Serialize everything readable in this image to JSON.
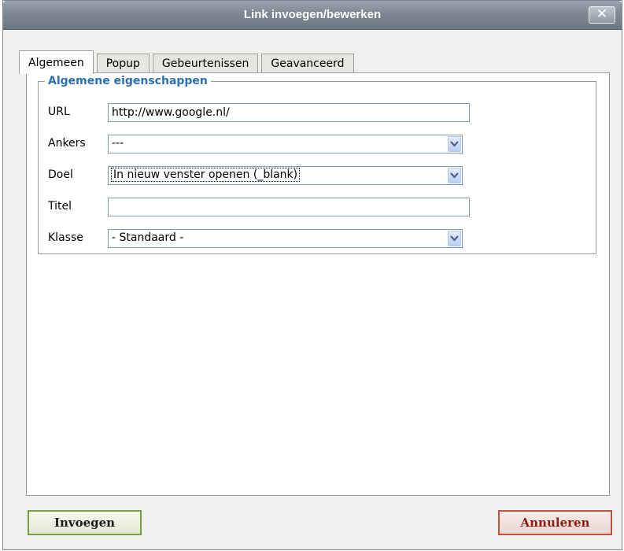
{
  "window": {
    "title": "Link invoegen/bewerken",
    "close_label": "✕"
  },
  "tabs": [
    {
      "label": "Algemeen",
      "active": true
    },
    {
      "label": "Popup",
      "active": false
    },
    {
      "label": "Gebeurtenissen",
      "active": false
    },
    {
      "label": "Geavanceerd",
      "active": false
    }
  ],
  "general": {
    "legend": "Algemene eigenschappen",
    "url": {
      "label": "URL",
      "value": "http://www.google.nl/"
    },
    "anchors": {
      "label": "Ankers",
      "value": "---"
    },
    "target": {
      "label": "Doel",
      "value": "In nieuw venster openen (_blank)"
    },
    "title": {
      "label": "Titel",
      "value": ""
    },
    "class": {
      "label": "Klasse",
      "value": "- Standaard -"
    }
  },
  "buttons": {
    "insert": "Invoegen",
    "cancel": "Annuleren"
  },
  "colors": {
    "legend": "#2b6fb6",
    "insert_border": "#72a23a",
    "cancel_border": "#c6523e",
    "titlebar": "#7e8893"
  }
}
